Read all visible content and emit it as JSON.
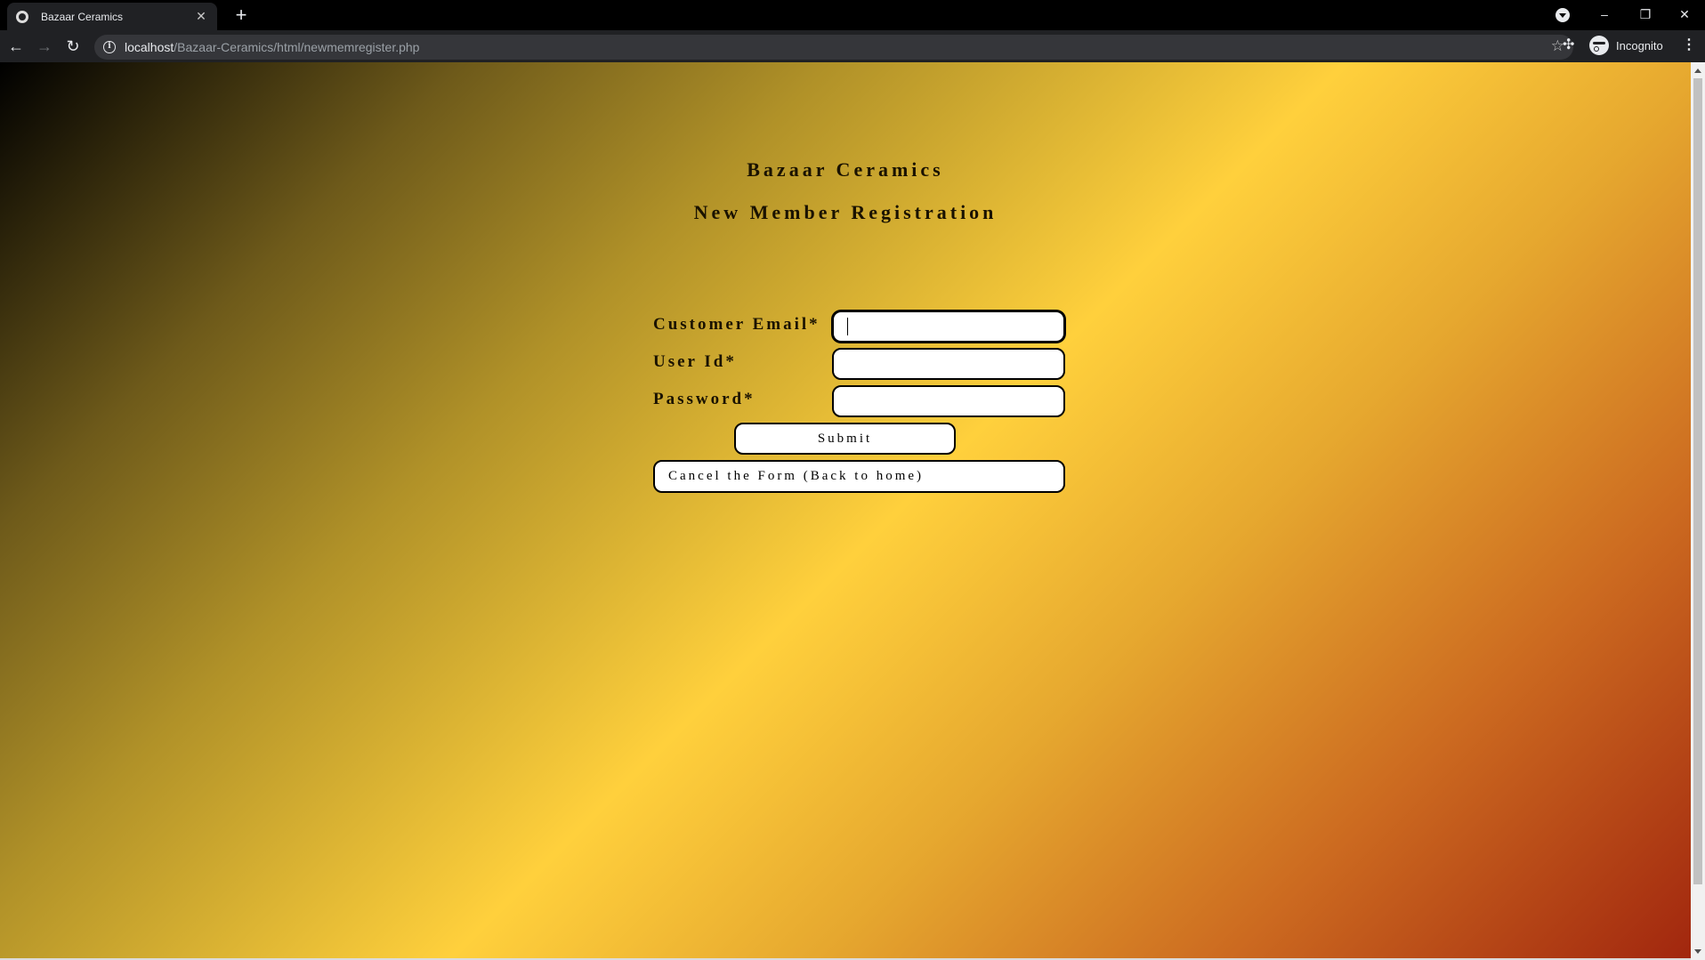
{
  "browser": {
    "tab": {
      "title": "Bazaar Ceramics",
      "favicon": "globe-icon",
      "close_glyph": "✕"
    },
    "new_tab_glyph": "+",
    "address": {
      "host": "localhost",
      "path": "/Bazaar-Ceramics/html/newmemregister.php"
    },
    "profile": {
      "label": "Incognito"
    },
    "icons": {
      "back": "arrow-left-icon",
      "forward": "arrow-right-icon",
      "reload": "reload-icon",
      "info": "info-icon",
      "bookmark": "star-icon",
      "extensions": "puzzle-icon",
      "menu": "kebab-menu-icon"
    },
    "window_controls": {
      "minimize": "–",
      "restore": "❐",
      "close": "✕"
    }
  },
  "page": {
    "title": "Bazaar Ceramics",
    "subtitle": "New Member Registration",
    "form": {
      "email_label": "Customer Email*",
      "email_value": "",
      "userid_label": "User Id*",
      "userid_value": "",
      "password_label": "Password*",
      "password_value": "",
      "submit_label": "Submit",
      "cancel_label": "Cancel the Form (Back to home)"
    },
    "colors": {
      "gradient_start": "#000000",
      "gradient_mid": "#ffd03c",
      "gradient_end": "#a1260e"
    }
  }
}
